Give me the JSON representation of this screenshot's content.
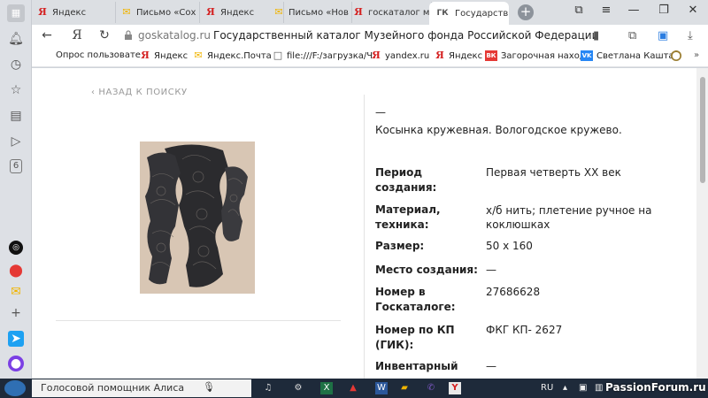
{
  "tabs": [
    {
      "label": "Яндекс",
      "icon": "yandex-icon"
    },
    {
      "label": "Письмо «Сох",
      "icon": "mail-icon"
    },
    {
      "label": "Яндекс",
      "icon": "yandex-icon"
    },
    {
      "label": "Письмо «Нов",
      "icon": "mail-icon"
    },
    {
      "label": "госкаталог м",
      "icon": "yandex-icon"
    },
    {
      "label": "Государств",
      "icon": "gk-icon",
      "prefix": "ГК"
    }
  ],
  "address": {
    "domain": "goskatalog.ru",
    "title": "Государственный каталог Музейного фонда Российской Федерации"
  },
  "bookmarks": [
    {
      "label": "Опрос пользовате",
      "icon": ""
    },
    {
      "label": "Яндекс",
      "icon": "Я"
    },
    {
      "label": "Яндекс.Почта",
      "icon": "✉"
    },
    {
      "label": "file:///F:/загрузка/Ч",
      "icon": "□"
    },
    {
      "label": "yandex.ru",
      "icon": "Я"
    },
    {
      "label": "Яндекс",
      "icon": "Я"
    },
    {
      "label": "Загорочная находк",
      "icon": "ВК"
    },
    {
      "label": "Светлана Кашта",
      "icon": "VK"
    }
  ],
  "page": {
    "back_link": "НАЗАД К ПОИСКУ",
    "dash": "—",
    "title": "Косынка кружевная. Вологодское кружево.",
    "fields": [
      {
        "label": "Период создания:",
        "value": "Первая четверть XX век"
      },
      {
        "label": "Материал, техника:",
        "value": "х/б нить; плетение ручное на коклюшках"
      },
      {
        "label": "Размер:",
        "value": "50 х 160"
      },
      {
        "label": "Место создания:",
        "value": "—"
      },
      {
        "label": "Номер в Госкаталоге:",
        "value": "27686628"
      },
      {
        "label": "Номер по КП (ГИК):",
        "value": "ФКГ КП- 2627"
      },
      {
        "label": "Инвентарный номер:",
        "value": "—"
      }
    ]
  },
  "taskbar": {
    "search_placeholder": "Голосовой помощник Алиса",
    "lang": "RU",
    "watermark": "PassionForum.ru"
  },
  "colors": {
    "yandex_red": "#d42020",
    "mail_yellow": "#f0b400",
    "taskbar": "#1e2a3a"
  }
}
